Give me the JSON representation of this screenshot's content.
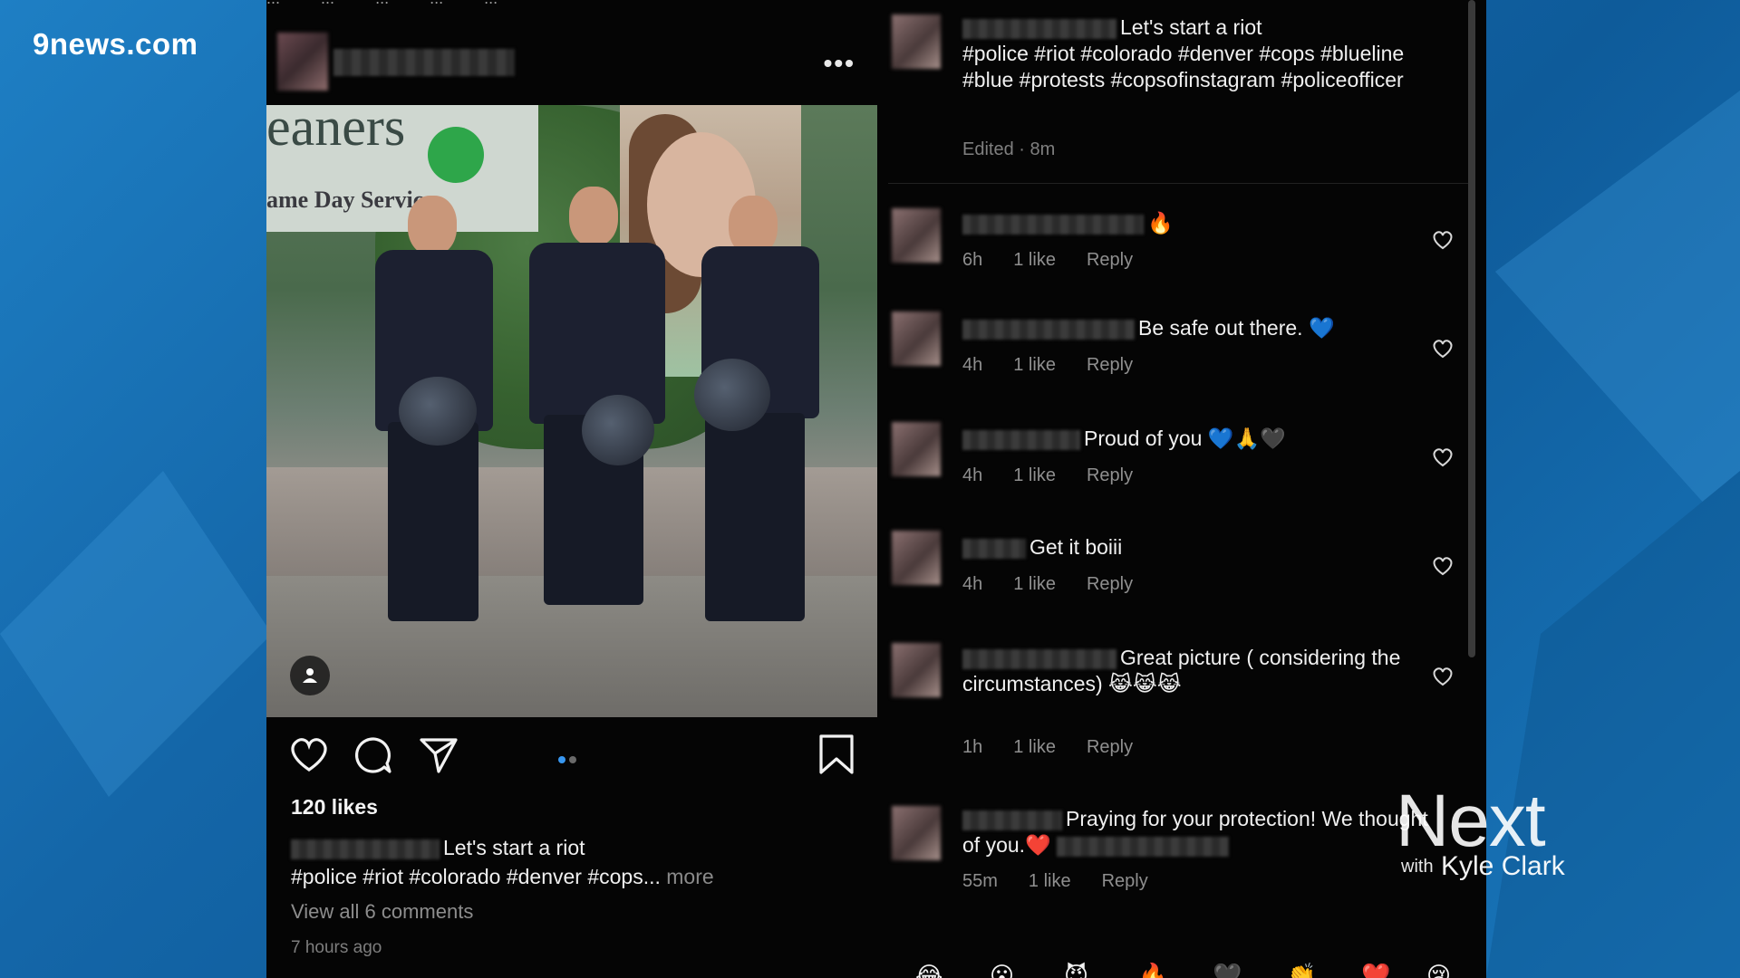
{
  "broadcast": {
    "logo": "9news.com",
    "show_logo_main": "Next",
    "show_logo_with": "with",
    "show_logo_host": "Kyle Clark"
  },
  "post": {
    "top_strip": [
      "...",
      "...",
      "...",
      "...",
      "..."
    ],
    "more_icon": "more-dots-icon",
    "photo_sign_text": "eaners",
    "photo_sign_sub": "ame Day Service.",
    "likes": "120 likes",
    "caption_text": "Let's start a riot",
    "caption_tags": "#police #riot #colorado #denver #cops...",
    "caption_more": "more",
    "view_comments": "View all 6 comments",
    "timestamp": "7 hours ago",
    "action_icons": [
      "heart-icon",
      "comment-icon",
      "send-icon",
      "bookmark-icon"
    ]
  },
  "comments": {
    "caption": {
      "text": "Let's start a riot",
      "tags": "#police #riot #colorado #denver #cops #blueline #blue #protests #copsofinstagram #policeofficer",
      "edited": "Edited · 8m"
    },
    "items": [
      {
        "text": "🔥",
        "time": "6h",
        "likes": "1 like",
        "reply": "Reply"
      },
      {
        "text": "Be safe out there. 💙",
        "time": "4h",
        "likes": "1 like",
        "reply": "Reply"
      },
      {
        "text": "Proud of you 💙🙏🖤",
        "time": "4h",
        "likes": "1 like",
        "reply": "Reply"
      },
      {
        "text": "Get it boiii",
        "time": "4h",
        "likes": "1 like",
        "reply": "Reply"
      },
      {
        "text": "Great picture ( considering the circumstances) 😹😹😹",
        "time": "1h",
        "likes": "1 like",
        "reply": "Reply"
      },
      {
        "text": "Praying for your protection! We thought of you.❤️",
        "time": "55m",
        "likes": "1 like",
        "reply": "Reply"
      }
    ],
    "emoji_bar": [
      "😂",
      "😮",
      "😈",
      "🔥",
      "🖤",
      "👏",
      "❤️",
      "😢"
    ]
  },
  "colors": {
    "background_blue": "#1466a8",
    "instagram_bg": "#050505",
    "carousel_active": "#3897f0"
  }
}
